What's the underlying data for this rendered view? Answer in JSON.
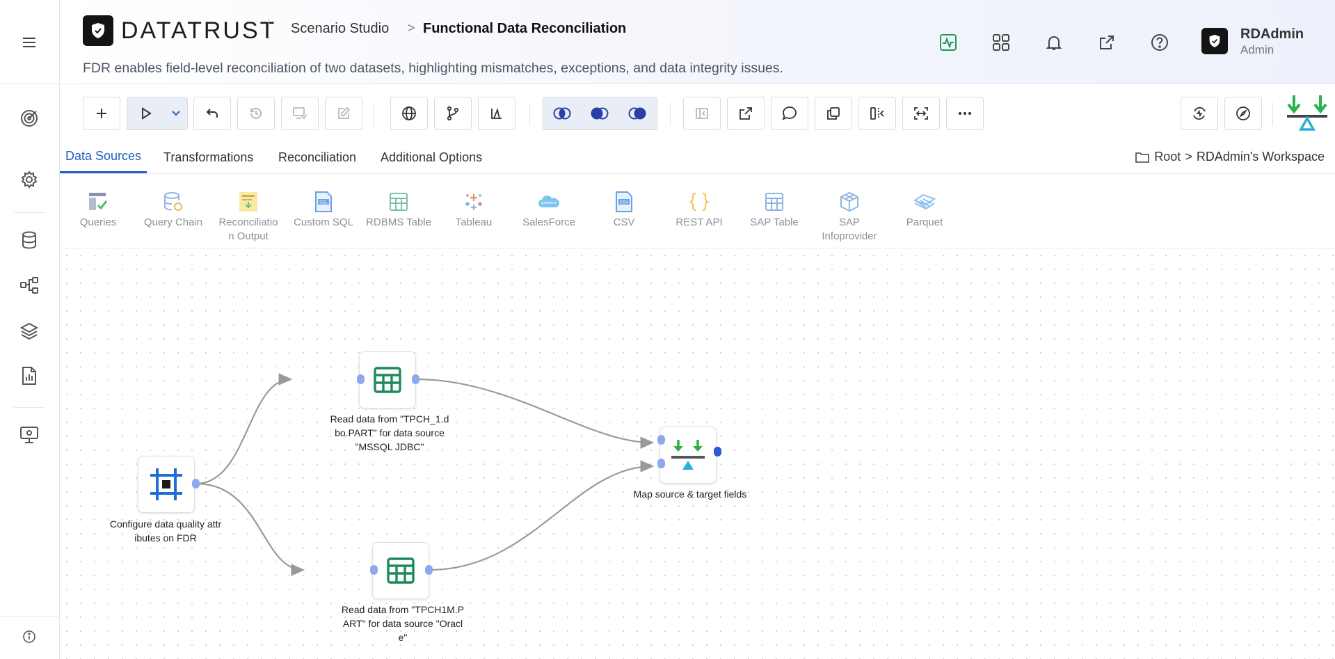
{
  "app": {
    "brand": "DATATRUST"
  },
  "header": {
    "breadcrumb_root": "Scenario Studio",
    "breadcrumb_sep": ">",
    "breadcrumb_current": "Functional Data Reconciliation",
    "subtitle": "FDR enables field-level reconciliation of two datasets, highlighting mismatches, exceptions, and data integrity issues."
  },
  "user": {
    "name": "RDAdmin",
    "role": "Admin"
  },
  "tabs": [
    {
      "label": "Data Sources",
      "active": true
    },
    {
      "label": "Transformations",
      "active": false
    },
    {
      "label": "Reconciliation",
      "active": false
    },
    {
      "label": "Additional Options",
      "active": false
    }
  ],
  "workspace_path": {
    "root": "Root",
    "sep": ">",
    "workspace": "RDAdmin's Workspace"
  },
  "palette": [
    {
      "label": "Queries",
      "icon": "queries-icon"
    },
    {
      "label": "Query Chain",
      "icon": "query-chain-icon"
    },
    {
      "label": "Reconciliatio",
      "label2": "n Output",
      "icon": "reconciliation-output-icon"
    },
    {
      "label": "Custom SQL",
      "icon": "custom-sql-icon"
    },
    {
      "label": "RDBMS Table",
      "icon": "rdbms-table-icon"
    },
    {
      "label": "Tableau",
      "icon": "tableau-icon"
    },
    {
      "label": "SalesForce",
      "icon": "salesforce-icon"
    },
    {
      "label": "CSV",
      "icon": "csv-icon"
    },
    {
      "label": "REST API",
      "icon": "rest-api-icon"
    },
    {
      "label": "SAP Table",
      "icon": "sap-table-icon"
    },
    {
      "label": "SAP",
      "label2": "Infoprovider",
      "icon": "sap-infoprovider-icon"
    },
    {
      "label": "Parquet",
      "icon": "parquet-icon"
    }
  ],
  "nodes": {
    "config": {
      "label1": "Configure data quality attr",
      "label2": "ibutes on FDR"
    },
    "read1": {
      "label1": "Read data from \"TPCH_1.d",
      "label2": "bo.PART\" for data source",
      "label3": "\"MSSQL JDBC\""
    },
    "read2": {
      "label1": "Read data from \"TPCH1M.P",
      "label2": "ART\" for data source \"Oracl",
      "label3": "e\""
    },
    "map": {
      "label1": "Map source & target fields"
    }
  },
  "colors": {
    "accent": "#1f5fbf",
    "node_green": "#1e8a5a",
    "node_blue": "#1f6fd6",
    "arrow_green": "#2bb24c",
    "triangle": "#2bb0d8",
    "port": "#8ea8f0"
  }
}
